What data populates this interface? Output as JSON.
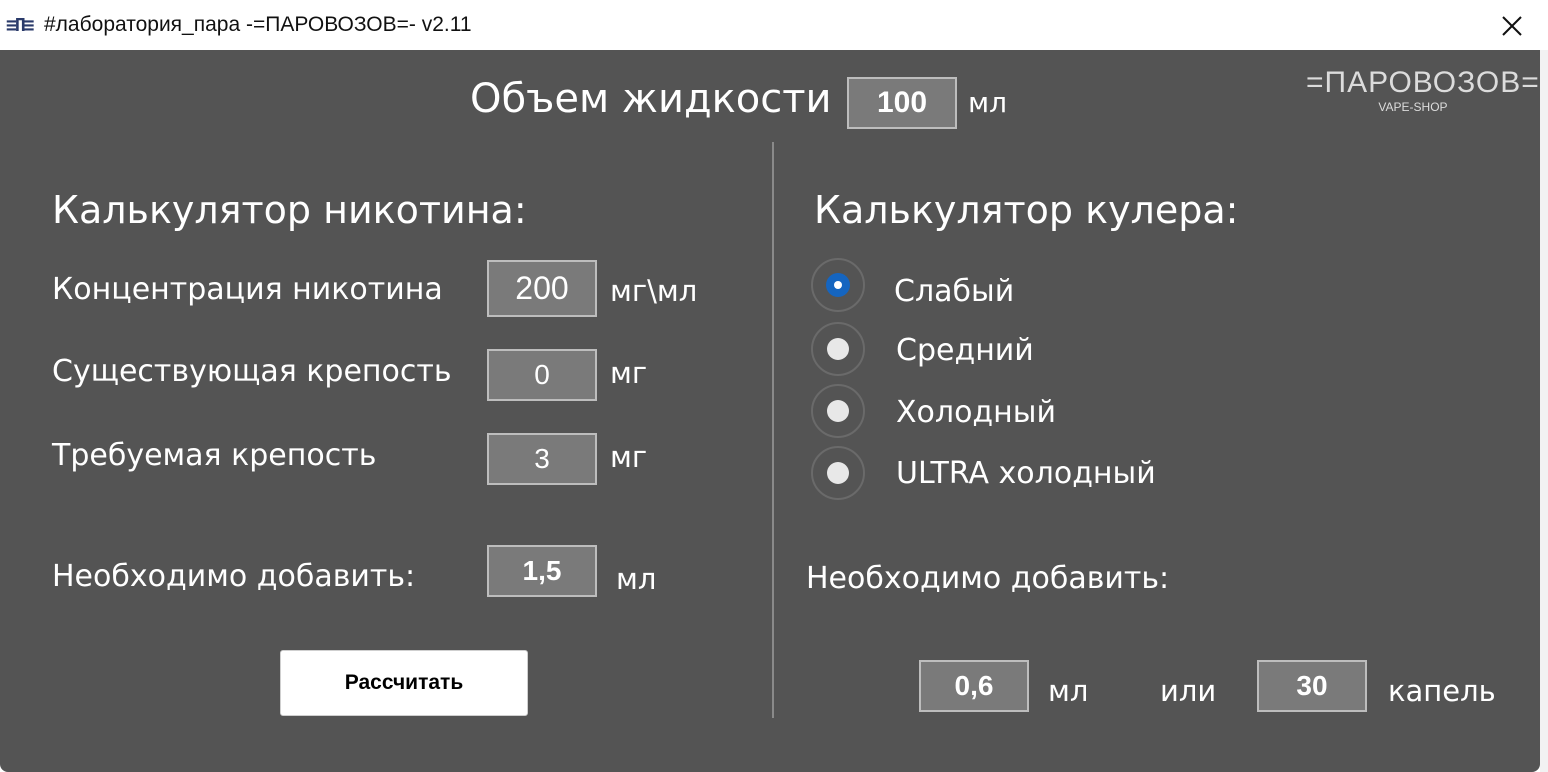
{
  "window": {
    "title": "#лаборатория_пара -=ПАРОВОЗОВ=- v2.11",
    "icon": "app-logo-icon",
    "icon_glyph": "≡П≡"
  },
  "logo": {
    "main": "=ПАРОВОЗОВ=",
    "sub": "VAPE-SHOP"
  },
  "volume": {
    "label": "Объем жидкости",
    "value": "100",
    "unit": "мл"
  },
  "nicotine": {
    "title": "Калькулятор никотина:",
    "concentration": {
      "label": "Концентрация никотина",
      "value": "200",
      "unit": "мг\\мл"
    },
    "existing": {
      "label": "Существующая крепость",
      "value": "0",
      "unit": "мг"
    },
    "required": {
      "label": "Требуемая крепость",
      "value": "3",
      "unit": "мг"
    },
    "result": {
      "label": "Необходимо добавить:",
      "value": "1,5",
      "unit": "мл"
    },
    "calculate_label": "Рассчитать"
  },
  "cooler": {
    "title": "Калькулятор кулера:",
    "options": [
      {
        "label": "Слабый",
        "checked": true
      },
      {
        "label": "Средний",
        "checked": false
      },
      {
        "label": "Холодный",
        "checked": false
      },
      {
        "label": "ULTRA холодный",
        "checked": false
      }
    ],
    "result_label": "Необходимо добавить:",
    "ml_value": "0,6",
    "ml_unit": "мл",
    "or_label": "или",
    "drops_value": "30",
    "drops_unit": "капель"
  },
  "colors": {
    "background": "#545454",
    "field": "#7a7a7a",
    "radio_accent": "#1565c0"
  }
}
